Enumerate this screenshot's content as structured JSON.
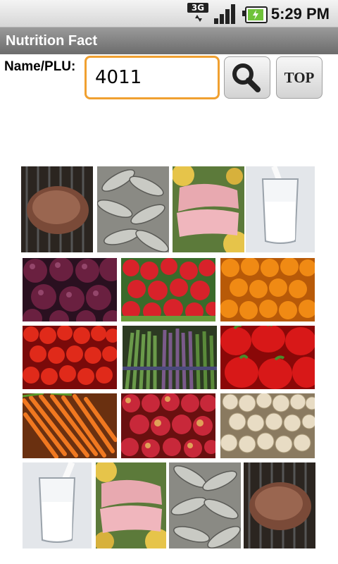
{
  "status_bar": {
    "network": "3G",
    "time": "5:29 PM"
  },
  "app": {
    "title": "Nutrition Fact"
  },
  "search": {
    "label": "Name/PLU:",
    "value": "4011",
    "top_label": "TOP"
  },
  "grid": [
    {
      "name": "steak-image"
    },
    {
      "name": "fish-image"
    },
    {
      "name": "pork-image"
    },
    {
      "name": "milk-image"
    },
    {
      "name": "plums-image"
    },
    {
      "name": "strawberries-image"
    },
    {
      "name": "oranges-image"
    },
    {
      "name": "tomatoes-image"
    },
    {
      "name": "asparagus-image"
    },
    {
      "name": "peppers-image"
    },
    {
      "name": "carrots-image"
    },
    {
      "name": "apples-image"
    },
    {
      "name": "mushrooms-image"
    },
    {
      "name": "milk-image-2"
    },
    {
      "name": "pork-image-2"
    },
    {
      "name": "fish-image-2"
    },
    {
      "name": "steak-image-2"
    }
  ]
}
